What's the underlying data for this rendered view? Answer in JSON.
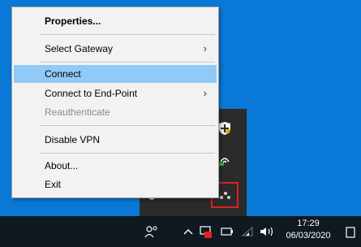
{
  "menu": {
    "items": [
      {
        "label": "Properties...",
        "bold": true
      },
      {
        "label": "Select Gateway",
        "arrow": "›"
      },
      {
        "label": "Connect",
        "highlighted": true
      },
      {
        "label": "Connect to End-Point",
        "arrow": "›"
      },
      {
        "label": "Reauthenticate",
        "disabled": true
      },
      {
        "label": "Disable VPN"
      },
      {
        "label": "About..."
      },
      {
        "label": "Exit"
      }
    ]
  },
  "taskbar": {
    "time": "17:29",
    "date": "06/03/2020"
  },
  "colors": {
    "desktop": "#0a78d7",
    "highlight": "#91c9f7",
    "taskbar": "#101820",
    "tray_flyout": "#2b2b2b",
    "selection_border": "#e02020"
  },
  "icons": [
    "shield-icon",
    "wifi-icon",
    "vpn-icon",
    "people-icon",
    "chevron-up-icon",
    "network-icon",
    "battery-icon",
    "wifi-signal-icon",
    "volume-icon",
    "notification-icon"
  ]
}
